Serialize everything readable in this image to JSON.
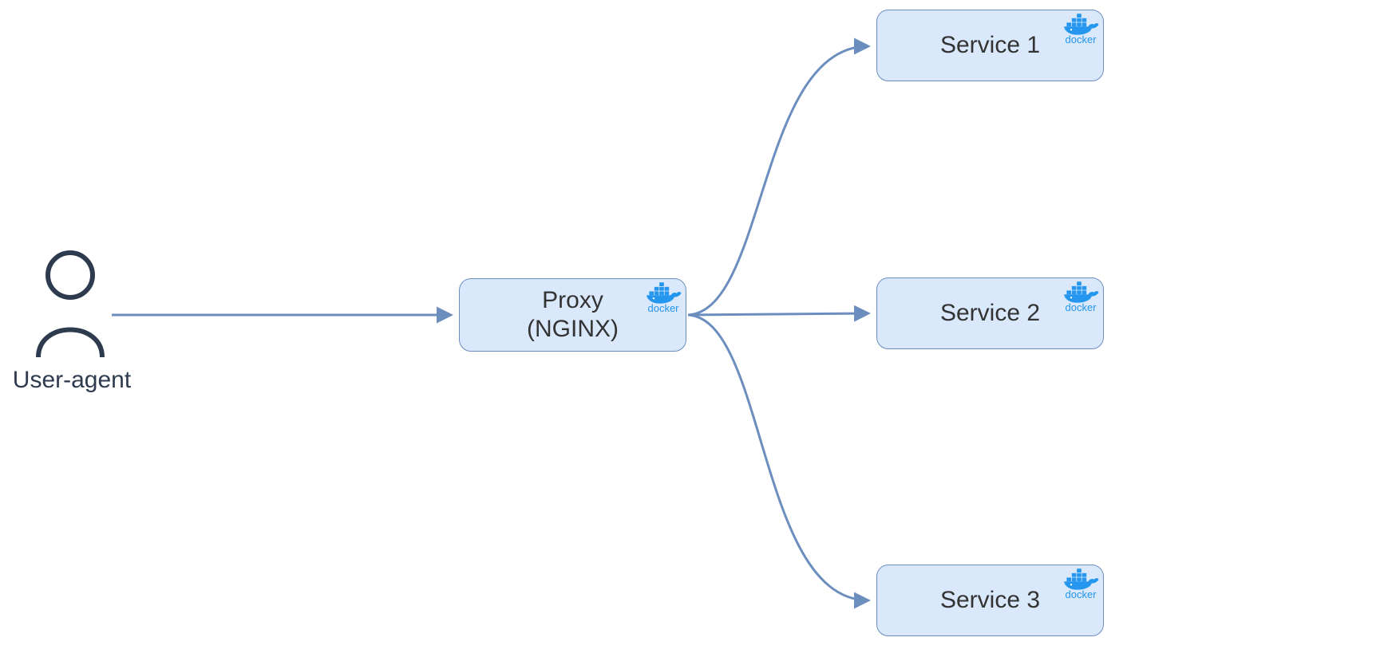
{
  "nodes": {
    "user": {
      "label": "User-agent"
    },
    "proxy": {
      "line1": "Proxy",
      "line2": "(NGINX)"
    },
    "service1": {
      "label": "Service 1"
    },
    "service2": {
      "label": "Service 2"
    },
    "service3": {
      "label": "Service 3"
    }
  },
  "icon": {
    "docker_label": "docker"
  },
  "colors": {
    "box_fill": "#dae8fc",
    "box_border": "#6c8ebf",
    "arrow": "#6c8ebf",
    "user_stroke": "#2e3b4e",
    "docker_blue": "#2496ed"
  }
}
